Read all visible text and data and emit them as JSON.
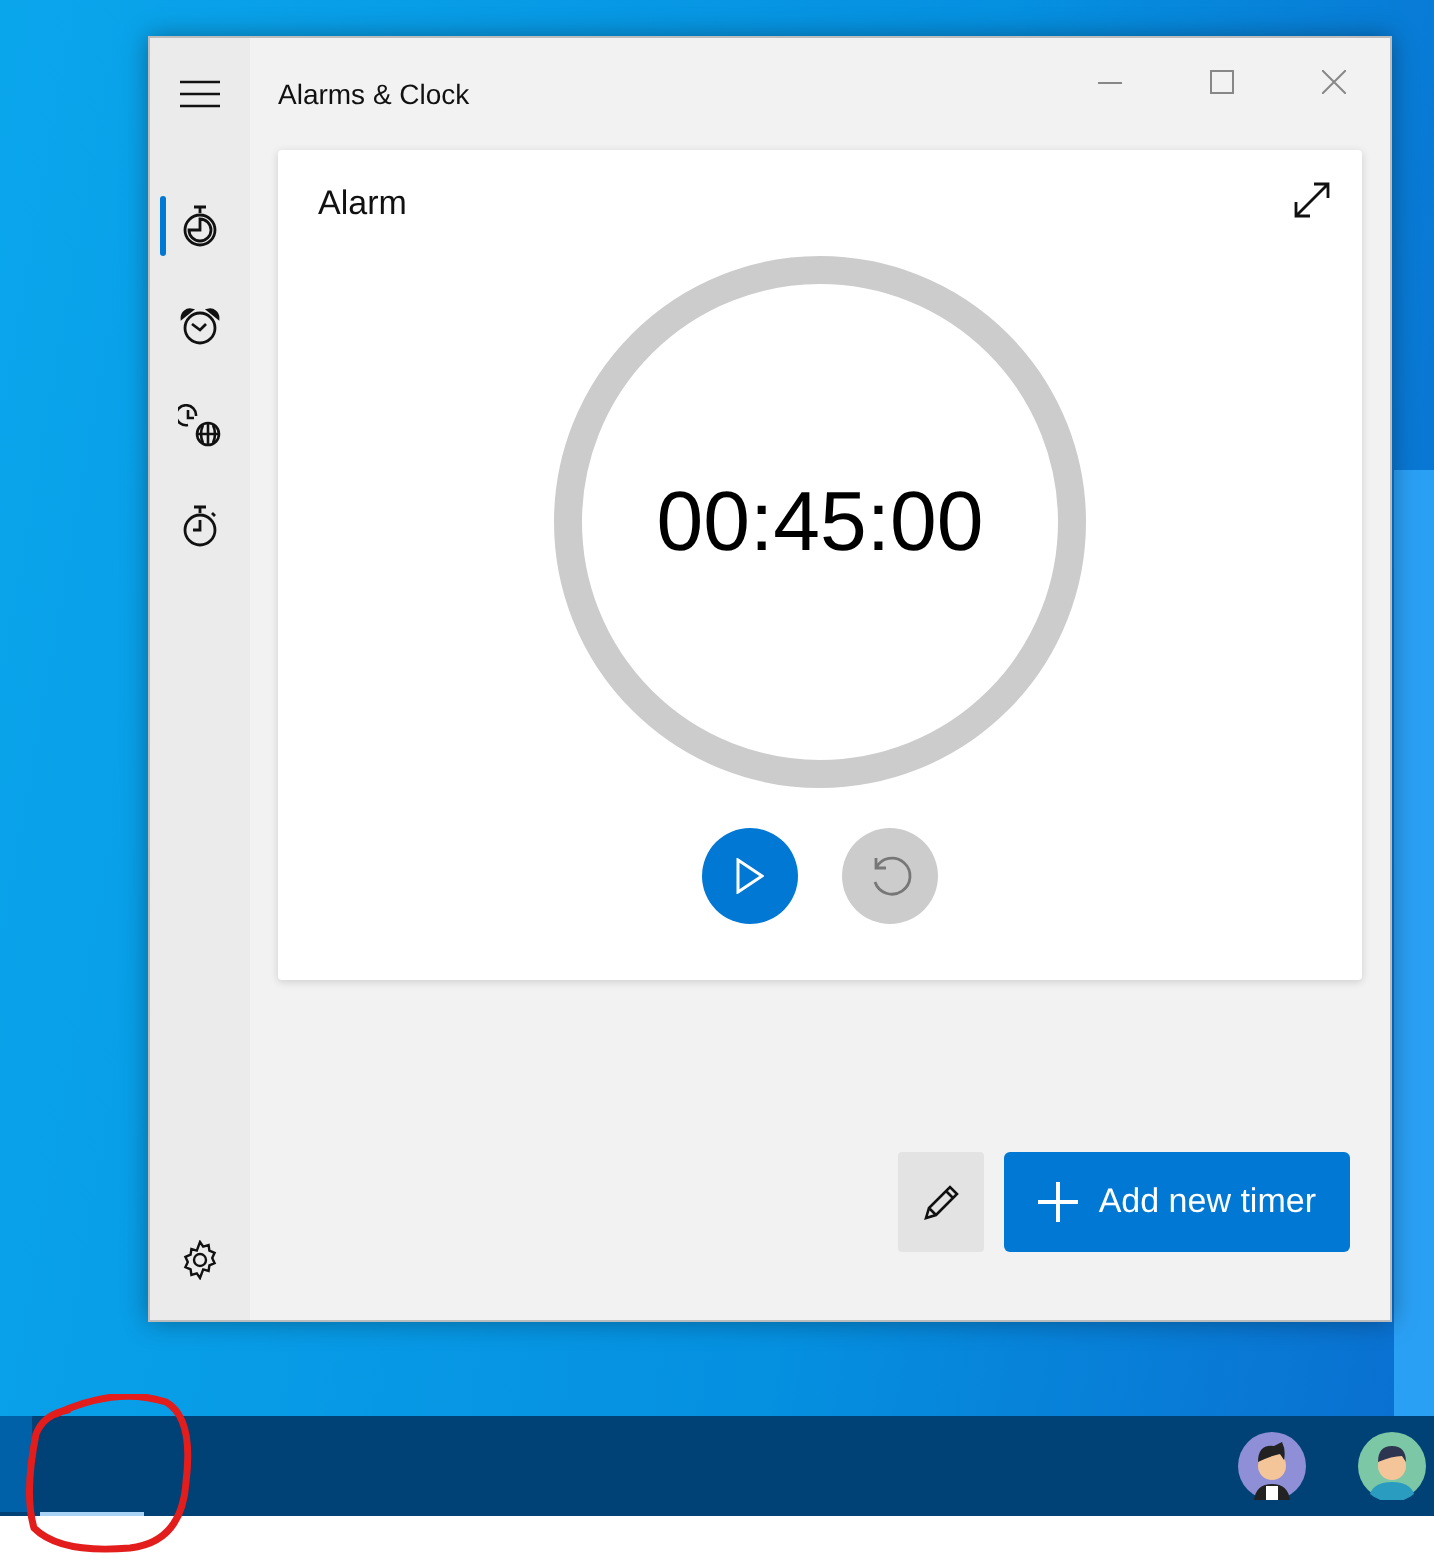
{
  "window": {
    "title": "Alarms & Clock"
  },
  "nav": [
    {
      "kind": "timer",
      "selected": true
    },
    {
      "kind": "alarm",
      "selected": false
    },
    {
      "kind": "world-clock",
      "selected": false
    },
    {
      "kind": "stopwatch",
      "selected": false
    }
  ],
  "timer_card": {
    "title": "Alarm",
    "time": "00:45:00",
    "play_disabled": false,
    "reset_disabled": true
  },
  "add_button": {
    "label": "Add new timer"
  }
}
